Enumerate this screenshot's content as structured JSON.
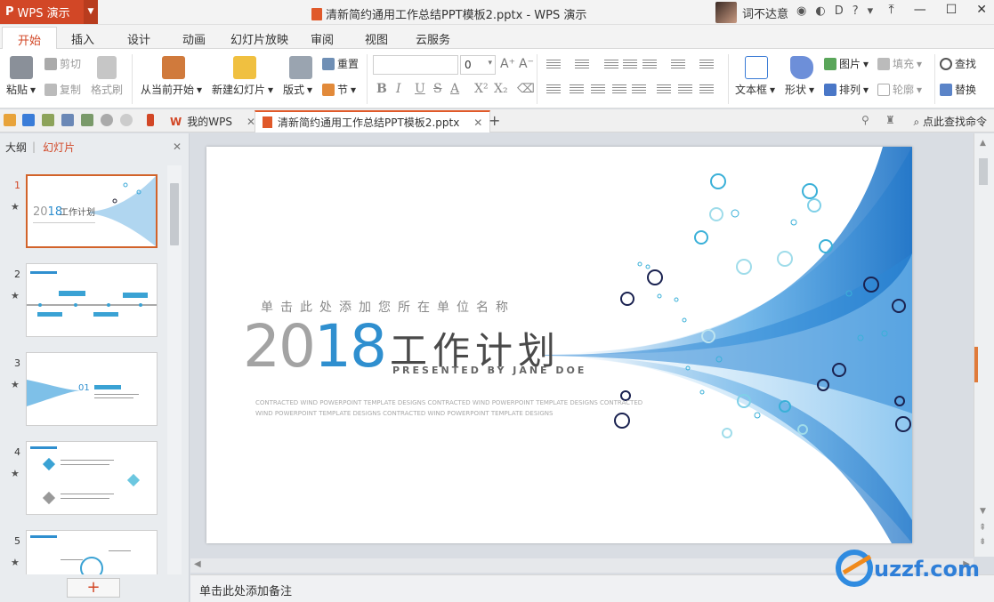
{
  "app": {
    "name": "WPS 演示",
    "logo": "P",
    "doc_title": "清新简约通用工作总结PPT模板2.pptx - WPS 演示",
    "user": "词不达意",
    "accent": "#d24726"
  },
  "tabs": [
    "开始",
    "插入",
    "设计",
    "动画",
    "幻灯片放映",
    "审阅",
    "视图",
    "云服务"
  ],
  "ribbon": {
    "paste": "粘贴",
    "cut": "剪切",
    "copy": "复制",
    "format_painter": "格式刷",
    "from_current": "从当前开始",
    "new_slide": "新建幻灯片",
    "layout": "版式",
    "reset": "重置",
    "section": "节",
    "font_size": "0",
    "textbox": "文本框",
    "shape": "形状",
    "picture": "图片",
    "fill": "填充",
    "arrange": "排列",
    "outline": "轮廓",
    "find": "查找",
    "replace": "替换"
  },
  "doc_tabs": {
    "home": "我的WPS",
    "file": "清新简约通用工作总结PPT模板2.pptx",
    "search": "点此查找命令"
  },
  "left_panel": {
    "outline_tab": "大纲",
    "slides_tab": "幻灯片",
    "slide_numbers": [
      "1",
      "2",
      "3",
      "4",
      "5"
    ],
    "add_button": "+"
  },
  "slide": {
    "subtitle": "单击此处添加您所在单位名称",
    "year_gray": "20",
    "year_blue": "18",
    "title": "工作计划",
    "presented": "PRESENTED BY JANE DOE",
    "paragraph": "CONTRACTED WIND POWERPOINT TEMPLATE DESIGNS CONTRACTED WIND POWERPOINT TEMPLATE DESIGNS CONTRACTED WIND POWERPOINT TEMPLATE DESIGNS CONTRACTED WIND POWERPOINT TEMPLATE DESIGNS"
  },
  "notes_placeholder": "单击此处添加备注",
  "watermark": "uzzf.com"
}
